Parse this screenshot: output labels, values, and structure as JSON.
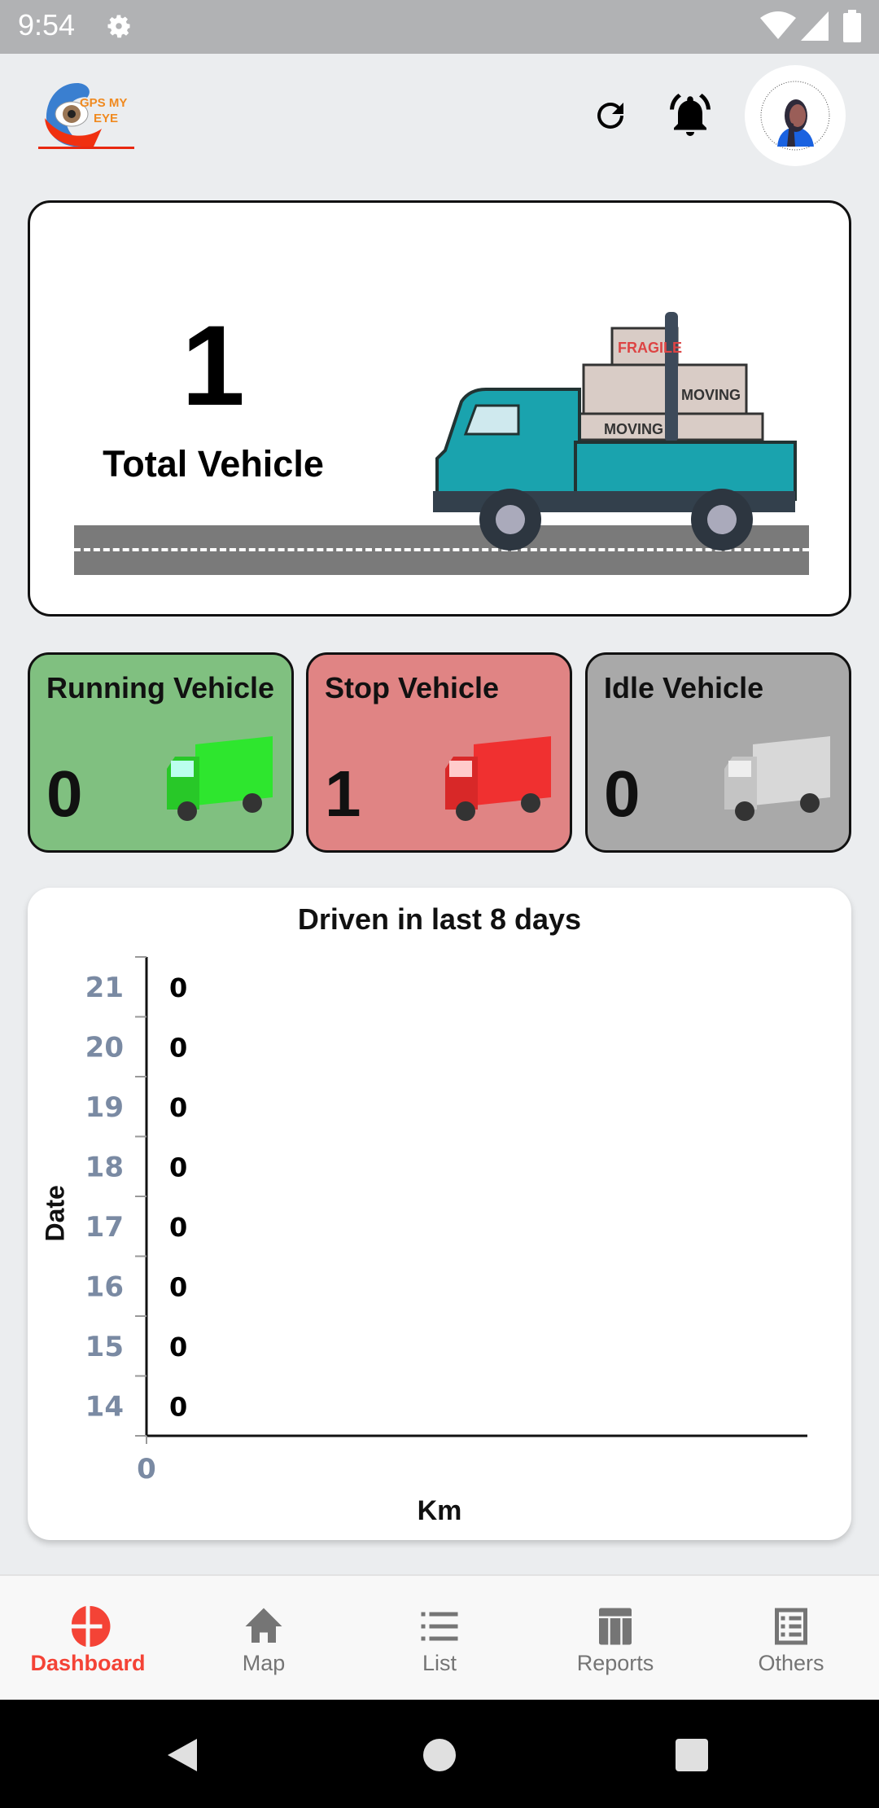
{
  "status_bar": {
    "time": "9:54",
    "icons": [
      "gear-icon",
      "wifi-icon",
      "signal-icon",
      "battery-icon"
    ]
  },
  "header": {
    "logo_text_line1": "GPS MY",
    "logo_text_line2": "EYE",
    "icons": [
      "refresh-icon",
      "bell-icon",
      "avatar"
    ]
  },
  "total": {
    "count": "1",
    "label": "Total Vehicle",
    "truck_labels": [
      "FRAGILE",
      "MOVING",
      "MOVING"
    ]
  },
  "status_cards": [
    {
      "label": "Running Vehicle",
      "count": "0",
      "color": "#80c080",
      "truck_color": "#2ee62e"
    },
    {
      "label": "Stop Vehicle",
      "count": "1",
      "color": "#e08484",
      "truck_color": "#f03030"
    },
    {
      "label": "Idle Vehicle",
      "count": "0",
      "color": "#a9a9a9",
      "truck_color": "#d0d0d0"
    }
  ],
  "chart_data": {
    "type": "bar",
    "orientation": "horizontal",
    "title": "Driven in last 8 days",
    "xlabel": "Km",
    "ylabel": "Date",
    "categories": [
      "21",
      "20",
      "19",
      "18",
      "17",
      "16",
      "15",
      "14"
    ],
    "values": [
      0,
      0,
      0,
      0,
      0,
      0,
      0,
      0
    ],
    "x_ticks": [
      "0"
    ],
    "grid": false
  },
  "bottom_nav": {
    "active_color": "#f44336",
    "items": [
      {
        "label": "Dashboard",
        "icon": "dashboard-pie-icon",
        "active": true
      },
      {
        "label": "Map",
        "icon": "home-icon",
        "active": false
      },
      {
        "label": "List",
        "icon": "list-icon",
        "active": false
      },
      {
        "label": "Reports",
        "icon": "reports-icon",
        "active": false
      },
      {
        "label": "Others",
        "icon": "others-icon",
        "active": false
      }
    ]
  }
}
